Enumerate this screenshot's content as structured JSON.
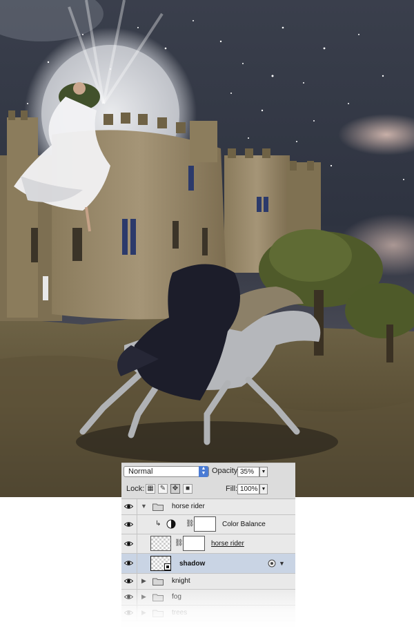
{
  "layers_panel": {
    "blend_mode": "Normal",
    "opacity_label": "Opacity:",
    "opacity_value": "35%",
    "lock_label": "Lock:",
    "fill_label": "Fill:",
    "fill_value": "100%",
    "layers": [
      {
        "name": "horse rider",
        "kind": "group",
        "expanded": true
      },
      {
        "name": "Color Balance",
        "kind": "adjustment"
      },
      {
        "name": "horse rider",
        "kind": "layer"
      },
      {
        "name": "shadow",
        "kind": "smart-object",
        "selected": true
      },
      {
        "name": "knight",
        "kind": "group",
        "expanded": false
      },
      {
        "name": "fog",
        "kind": "group",
        "expanded": false
      },
      {
        "name": "trees",
        "kind": "group",
        "expanded": false
      }
    ]
  }
}
